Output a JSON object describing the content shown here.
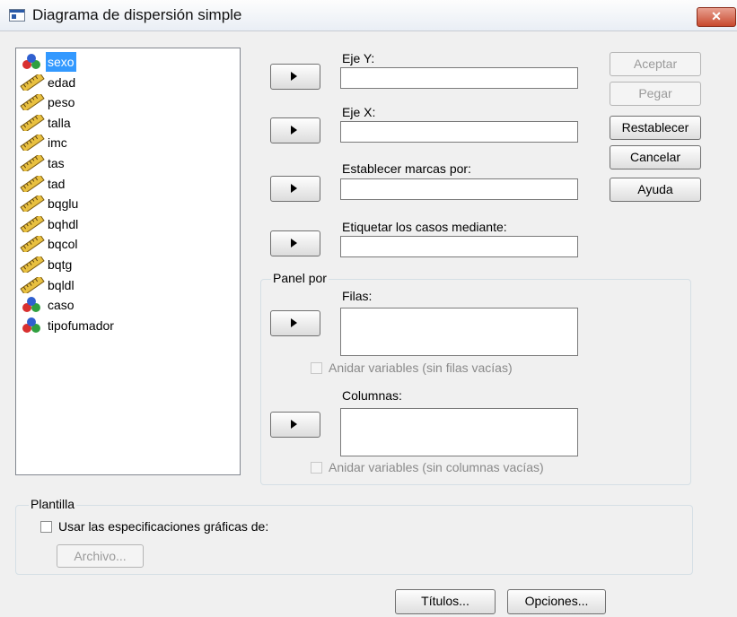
{
  "window": {
    "title": "Diagrama de dispersión simple",
    "close_label": "✕"
  },
  "variables": [
    {
      "name": "sexo",
      "type": "nominal",
      "selected": true
    },
    {
      "name": "edad",
      "type": "scale"
    },
    {
      "name": "peso",
      "type": "scale"
    },
    {
      "name": "talla",
      "type": "scale"
    },
    {
      "name": "imc",
      "type": "scale"
    },
    {
      "name": "tas",
      "type": "scale"
    },
    {
      "name": "tad",
      "type": "scale"
    },
    {
      "name": "bqglu",
      "type": "scale"
    },
    {
      "name": "bqhdl",
      "type": "scale"
    },
    {
      "name": "bqcol",
      "type": "scale"
    },
    {
      "name": "bqtg",
      "type": "scale"
    },
    {
      "name": "bqldl",
      "type": "scale"
    },
    {
      "name": "caso",
      "type": "nominal"
    },
    {
      "name": "tipofumador",
      "type": "nominal"
    }
  ],
  "fields": {
    "eje_y": {
      "label": "Eje Y:",
      "value": ""
    },
    "eje_x": {
      "label": "Eje X:",
      "value": ""
    },
    "marcas": {
      "label": "Establecer marcas por:",
      "value": ""
    },
    "etiquetar": {
      "label": "Etiquetar los casos mediante:",
      "value": ""
    }
  },
  "panel": {
    "legend": "Panel por",
    "filas_label": "Filas:",
    "filas_nest": "Anidar variables (sin filas vacías)",
    "columnas_label": "Columnas:",
    "columnas_nest": "Anidar variables (sin columnas vacías)"
  },
  "plantilla": {
    "legend": "Plantilla",
    "usar_label": "Usar las especificaciones gráficas de:",
    "archivo_label": "Archivo..."
  },
  "buttons": {
    "aceptar": "Aceptar",
    "pegar": "Pegar",
    "restablecer": "Restablecer",
    "cancelar": "Cancelar",
    "ayuda": "Ayuda",
    "titulos": "Títulos...",
    "opciones": "Opciones..."
  },
  "colors": {
    "selection": "#3399ff",
    "close": "#c84a2f"
  }
}
